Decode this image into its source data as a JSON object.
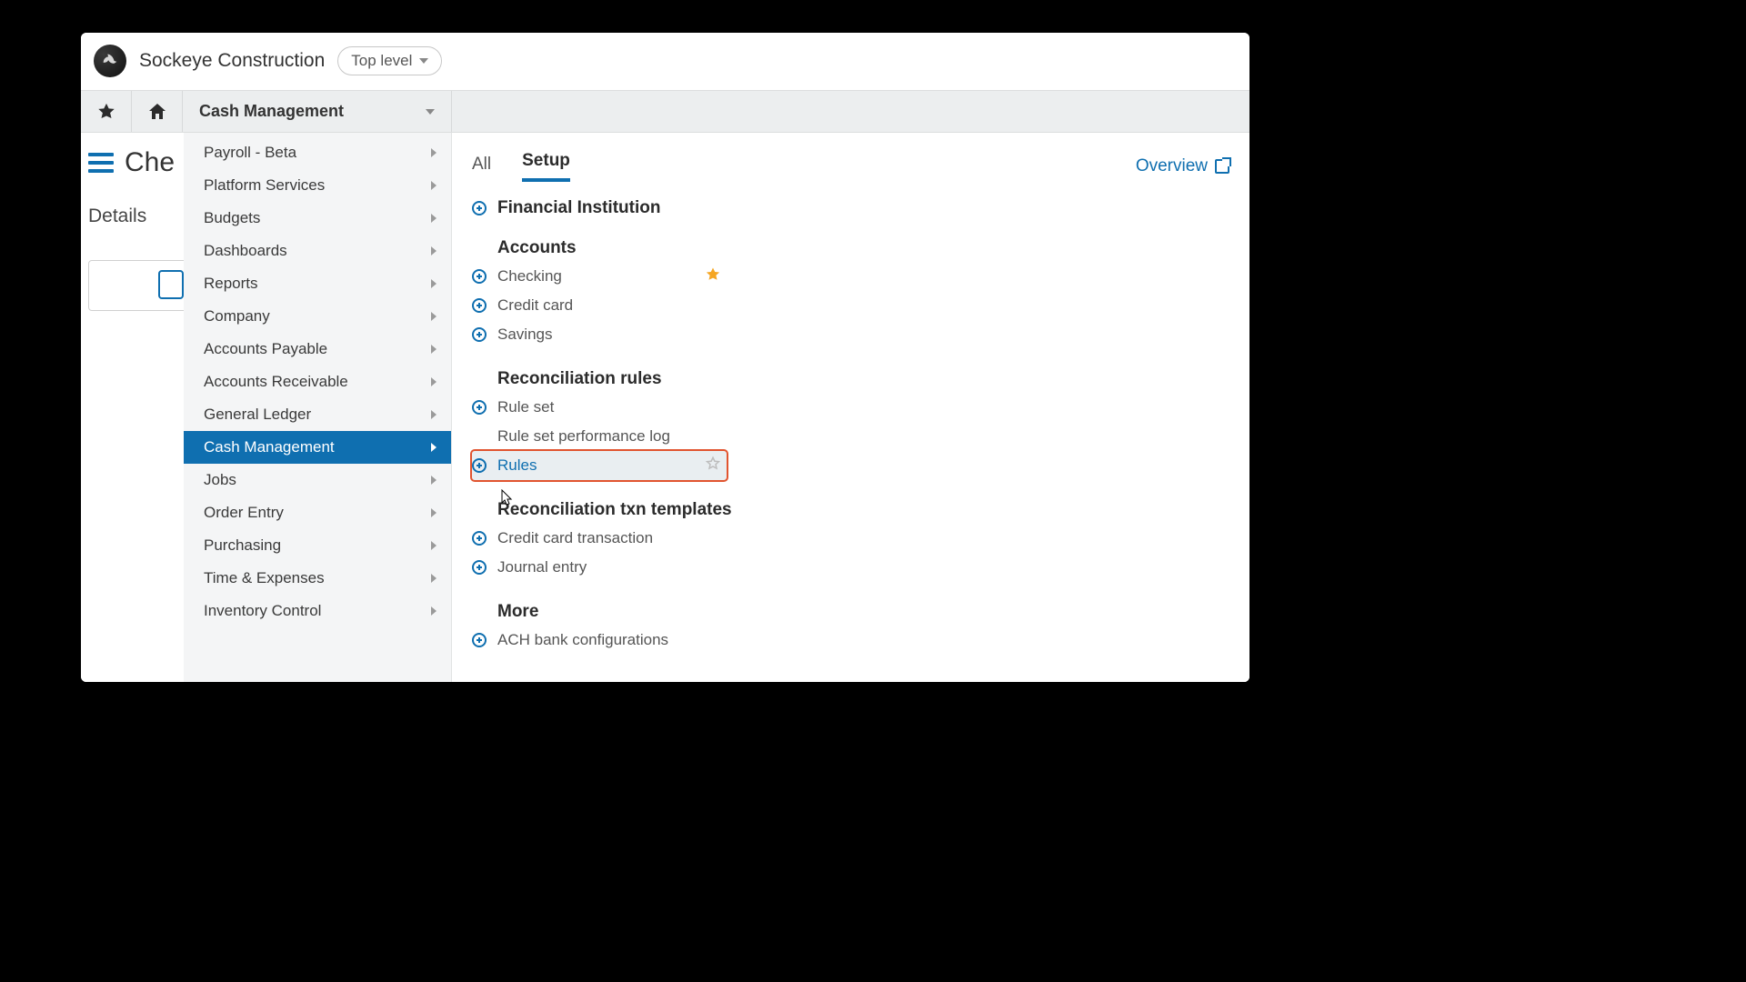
{
  "header": {
    "company": "Sockeye Construction",
    "level_label": "Top level"
  },
  "nav": {
    "module_label": "Cash Management"
  },
  "bg_page": {
    "title_prefix": "Che",
    "tab": "Details"
  },
  "mega": {
    "left_items": [
      {
        "label": "Payroll - Beta"
      },
      {
        "label": "Platform Services"
      },
      {
        "label": "Budgets"
      },
      {
        "label": "Dashboards"
      },
      {
        "label": "Reports"
      },
      {
        "label": "Company"
      },
      {
        "label": "Accounts Payable"
      },
      {
        "label": "Accounts Receivable"
      },
      {
        "label": "General Ledger"
      },
      {
        "label": "Cash Management",
        "active": true
      },
      {
        "label": "Jobs"
      },
      {
        "label": "Order Entry"
      },
      {
        "label": "Purchasing"
      },
      {
        "label": "Time & Expenses"
      },
      {
        "label": "Inventory Control"
      }
    ],
    "tabs": {
      "all": "All",
      "setup": "Setup",
      "overview": "Overview"
    },
    "sections": {
      "fin_inst": "Financial Institution",
      "accounts_title": "Accounts",
      "accounts": [
        {
          "label": "Checking",
          "starred": true
        },
        {
          "label": "Credit card"
        },
        {
          "label": "Savings"
        }
      ],
      "recon_title": "Reconciliation rules",
      "recon": [
        {
          "label": "Rule set",
          "plus": true
        },
        {
          "label": "Rule set performance log",
          "plus": false
        },
        {
          "label": "Rules",
          "plus": true,
          "highlight": true,
          "star_outline": true
        }
      ],
      "templates_title": "Reconciliation txn templates",
      "templates": [
        {
          "label": "Credit card transaction"
        },
        {
          "label": "Journal entry"
        }
      ],
      "more_title": "More",
      "more": [
        {
          "label": "ACH bank configurations"
        }
      ]
    }
  }
}
